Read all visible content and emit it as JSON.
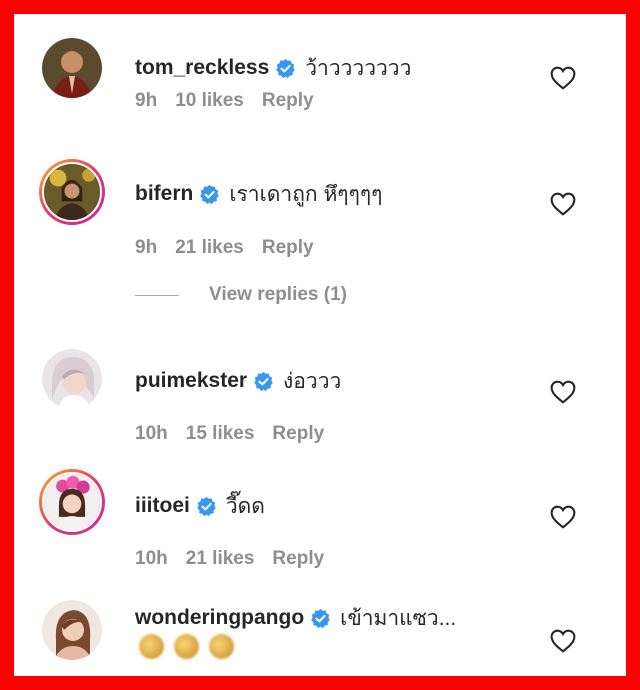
{
  "comments": [
    {
      "username": "tom_reckless",
      "text": "ว้าววววววว",
      "time": "9h",
      "likes": "10 likes",
      "reply": "Reply",
      "avatar_icon": "avatar-tom-reckless",
      "has_story_ring": false
    },
    {
      "username": "bifern",
      "text": "เราเดาถูก หึๆๆๆๆ",
      "time": "9h",
      "likes": "21 likes",
      "reply": "Reply",
      "avatar_icon": "avatar-bifern",
      "has_story_ring": true
    },
    {
      "username": "puimekster",
      "text": "ง่อววว",
      "time": "10h",
      "likes": "15 likes",
      "reply": "Reply",
      "avatar_icon": "avatar-puimekster",
      "has_story_ring": false
    },
    {
      "username": "iiitoei",
      "text": "วี๊ดด",
      "time": "10h",
      "likes": "21 likes",
      "reply": "Reply",
      "avatar_icon": "avatar-iiitoei",
      "has_story_ring": true
    },
    {
      "username": "wonderingpango",
      "text": "เข้ามาแซว...",
      "avatar_icon": "avatar-wonderingpango",
      "has_story_ring": false
    }
  ],
  "view_replies": "View replies (1)",
  "colors": {
    "border": "#ff0000",
    "verified": "#3897f0",
    "primary_text": "#262626",
    "secondary_text": "#8e8e8e"
  }
}
